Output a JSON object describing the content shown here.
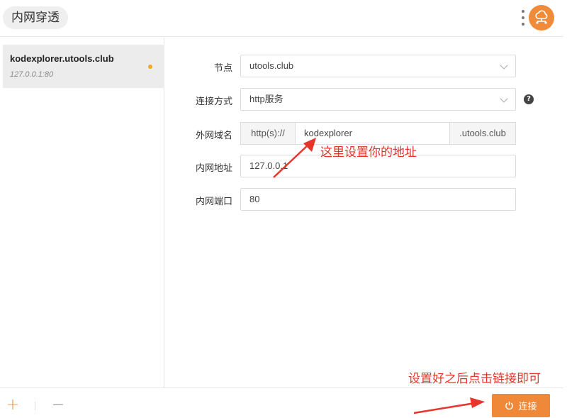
{
  "header": {
    "title": "内网穿透",
    "logo_icon": "cloud-network-icon",
    "menu_icon": "kebab-menu-icon"
  },
  "sidebar": {
    "tunnels": [
      {
        "name": "kodexplorer.utools.club",
        "address": "127.0.0.1:80",
        "status_color": "#f5a623"
      }
    ]
  },
  "form": {
    "node": {
      "label": "节点",
      "value": "utools.club"
    },
    "connection_type": {
      "label": "连接方式",
      "value": "http服务"
    },
    "external_domain": {
      "label": "外网域名",
      "prefix": "http(s)://",
      "value": "kodexplorer",
      "suffix": ".utools.club"
    },
    "internal_address": {
      "label": "内网地址",
      "value": "127.0.0.1"
    },
    "internal_port": {
      "label": "内网端口",
      "value": "80"
    }
  },
  "footer": {
    "add_label": "+",
    "remove_label": "−",
    "connect_label": "连接"
  },
  "annotations": {
    "domain_hint": "这里设置你的地址",
    "connect_hint": "设置好之后点击链接即可"
  },
  "colors": {
    "accent": "#f0883a",
    "annotation": "#e8342a"
  }
}
